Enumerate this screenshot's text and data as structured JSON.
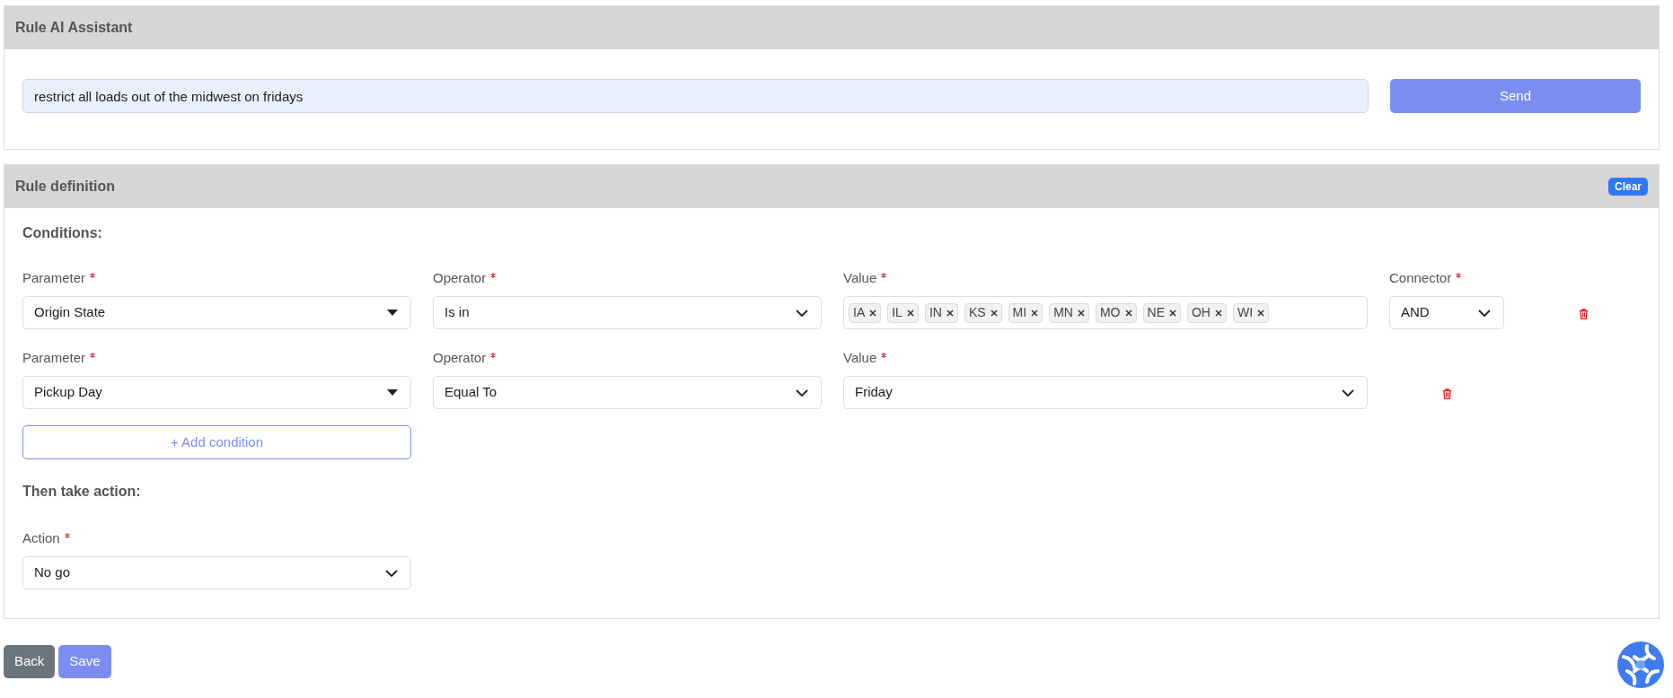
{
  "assistant": {
    "title": "Rule AI Assistant",
    "prompt": "restrict all loads out of the midwest on fridays",
    "send": "Send"
  },
  "rule": {
    "title": "Rule definition",
    "clear": "Clear",
    "conditions_heading": "Conditions:",
    "conditions": [
      {
        "fields": [
          {
            "kind": "caret",
            "label": "Parameter",
            "required": true,
            "value": "Origin State"
          },
          {
            "kind": "chevron",
            "label": "Operator",
            "required": true,
            "value": "Is in"
          },
          {
            "kind": "tags",
            "label": "Value",
            "required": true,
            "tags": [
              "IA",
              "IL",
              "IN",
              "KS",
              "MI",
              "MN",
              "MO",
              "NE",
              "OH",
              "WI"
            ]
          },
          {
            "kind": "chevron",
            "label": "Connector",
            "required": true,
            "value": "AND"
          }
        ]
      },
      {
        "fields": [
          {
            "kind": "caret",
            "label": "Parameter",
            "required": true,
            "value": "Pickup Day"
          },
          {
            "kind": "chevron",
            "label": "Operator",
            "required": true,
            "value": "Equal To"
          },
          {
            "kind": "chevron",
            "label": "Value",
            "required": true,
            "value": "Friday"
          }
        ]
      }
    ],
    "add_condition": "+ Add condition",
    "action_heading": "Then take action:",
    "action": {
      "kind": "chevron",
      "label": "Action",
      "required": true,
      "value": "No go"
    }
  },
  "footer": {
    "buttons": [
      {
        "kind": "secondary",
        "label": "Back"
      },
      {
        "kind": "primary",
        "label": "Save"
      }
    ]
  }
}
